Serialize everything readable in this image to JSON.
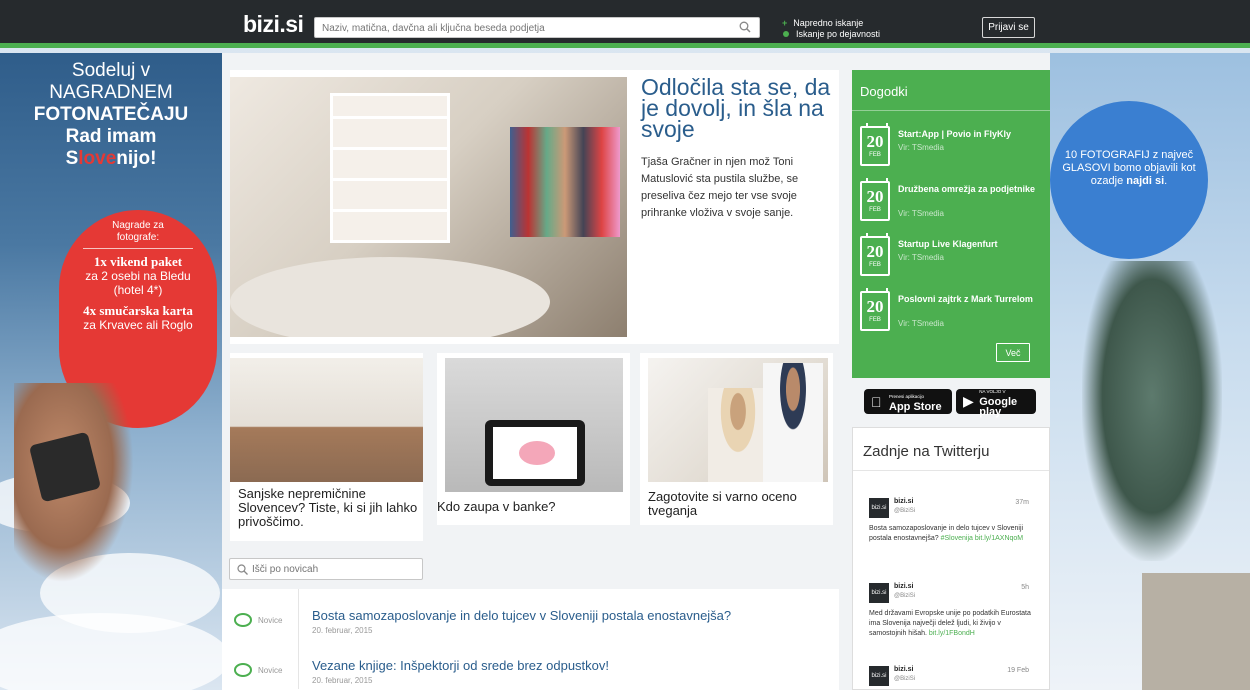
{
  "header": {
    "logo": "bizi.si",
    "search_placeholder": "Naziv, matična, davčna ali ključna beseda podjetja",
    "advanced_search": "Napredno iskanje",
    "activity_search": "Iskanje po dejavnosti",
    "login": "Prijavi se",
    "accent_color": "#4caf50"
  },
  "left_ad": {
    "line1": "Sodeluj v",
    "line2": "NAGRADNEM",
    "line3": "FOTONATEČAJU",
    "line4": "Rad imam",
    "slogan_a": "S",
    "slogan_b": "love",
    "slogan_c": "nijo!",
    "prizes_label": "Nagrade za fotografe:",
    "prize1_bold": "1x vikend paket",
    "prize1_rest": "za 2 osebi na Bledu (hotel 4*)",
    "prize2_bold": "4x smučarska karta",
    "prize2_rest": "za Krvavec ali Roglo"
  },
  "right_ad": {
    "text_a": "10 FOTOGRAFIJ z največ GLASOVI bomo objavili kot ozadje ",
    "text_b": "najdi si",
    "text_c": "."
  },
  "featured": {
    "title": "Odločila sta se, da je dovolj, in šla na svoje",
    "lead": "Tjaša Gračner in njen mož Toni Matuslović sta pustila službe, se preseliva čez mejo ter vse svoje prihranke vloživa v svoje sanje."
  },
  "small_articles": [
    {
      "caption": "Sanjske nepremičnine Slovencev? Tiste, ki si jih lahko privoščimo."
    },
    {
      "caption": "Kdo zaupa v banke?"
    },
    {
      "caption": "Zagotovite si varno oceno tveganja"
    }
  ],
  "news_search": {
    "placeholder": "Išči po novicah"
  },
  "news": [
    {
      "tag": "Novice",
      "title": "Bosta samozaposlovanje in delo tujcev v Sloveniji postala enostavnejša?",
      "date": "20. februar, 2015"
    },
    {
      "tag": "Novice",
      "title": "Vezane knjige: Inšpektorji od srede brez odpustkov!",
      "date": "20. februar, 2015"
    }
  ],
  "events": {
    "title": "Dogodki",
    "more": "Več",
    "items": [
      {
        "day": "20",
        "month": "FEB",
        "title": "Start:App | Povio in FlyKly",
        "source": "Vir: TSmedia"
      },
      {
        "day": "20",
        "month": "FEB",
        "title": "Družbena omrežja za podjetnike",
        "source": "Vir: TSmedia"
      },
      {
        "day": "20",
        "month": "FEB",
        "title": "Startup Live Klagenfurt",
        "source": "Vir: TSmedia"
      },
      {
        "day": "20",
        "month": "FEB",
        "title": "Poslovni zajtrk z Mark Turrelom",
        "source": "Vir: TSmedia"
      }
    ]
  },
  "stores": {
    "appstore_small": "Prenesi aplikacijo",
    "appstore_big": "App Store",
    "gplay_small": "NA VOLJO V",
    "gplay_big": "Google play"
  },
  "twitter": {
    "title": "Zadnje na Twitterju",
    "tweets": [
      {
        "avatar": "bizi.si",
        "name": "bizi.si",
        "handle": "@BiziSi",
        "time": "37m",
        "text": "Bosta samozaposlovanje in delo tujcev v Sloveniji postala enostavnejša? ",
        "hashtag": "#Slovenija",
        "link": "bit.ly/1AXNqoM"
      },
      {
        "avatar": "bizi.si",
        "name": "bizi.si",
        "handle": "@BiziSi",
        "time": "5h",
        "text": "Med državami Evropske unije po podatkih Eurostata ima Slovenija največji delež ljudi, ki živijo v samostojnih hišah. ",
        "hashtag": "",
        "link": "bit.ly/1FBondH"
      },
      {
        "avatar": "bizi.si",
        "name": "bizi.si",
        "handle": "@BiziSi",
        "time": "19 Feb",
        "text": "",
        "hashtag": "",
        "link": ""
      }
    ]
  }
}
